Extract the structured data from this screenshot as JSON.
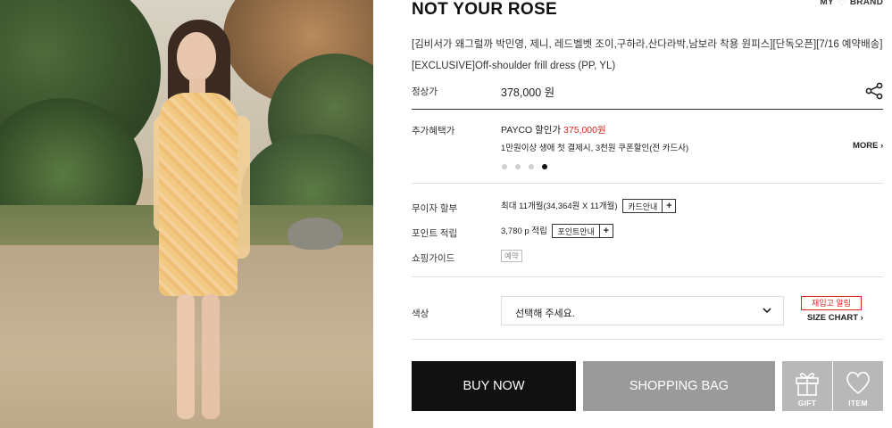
{
  "top_links": {
    "my": "MY",
    "brand": "BRAND"
  },
  "product": {
    "brand": "NOT YOUR ROSE",
    "name_line1": "[김비서가 왜그럴까 박민영, 제니, 레드벨벳 조이,구하라,산다라박,남보라 착용 원피스][단독오픈][7/16 예약배송]",
    "name_line2": "[EXCLUSIVE]Off-shoulder frill dress (PP, YL)",
    "image_alt": "model wearing yellow floral off-shoulder frill dress"
  },
  "price": {
    "label": "정상가",
    "value": "378,000 원"
  },
  "benefits": {
    "label": "추가혜택가",
    "payco_prefix": "PAYCO 할인가 ",
    "payco_price": "375,000원",
    "desc": "1만원이상 생애 첫 결제시, 3천원 쿠폰할인(전 카드사)",
    "more": "MORE",
    "carousel_count": 4,
    "carousel_active_index": 3
  },
  "installment": {
    "label": "무이자 할부",
    "value": "최대 11개월(34,364원 X 11개월)",
    "button": "카드안내",
    "plus": "+"
  },
  "points": {
    "label": "포인트 적립",
    "value": "3,780 p 적립",
    "button": "포인트안내",
    "plus": "+"
  },
  "shopping_guide": {
    "label": "쇼핑가이드",
    "badge": "예약"
  },
  "color": {
    "label": "색상",
    "placeholder": "선택해 주세요.",
    "restock": "재입고 알림",
    "size_chart": "SIZE CHART"
  },
  "actions": {
    "buy": "BUY NOW",
    "bag": "SHOPPING BAG",
    "gift": "GIFT",
    "item": "ITEM"
  },
  "colors": {
    "sale_red": "#d9261c",
    "buy_bg": "#111111",
    "bag_bg": "#9a9a9a",
    "icon_btn_bg": "#b8b8b8"
  }
}
